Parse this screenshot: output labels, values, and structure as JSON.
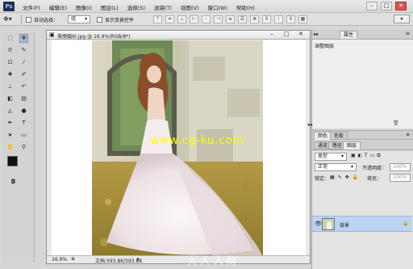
{
  "app": {
    "logo": "Ps",
    "menu": [
      "文件(F)",
      "编辑(E)",
      "图像(I)",
      "图层(L)",
      "选择(S)",
      "滤镜(T)",
      "视图(V)",
      "窗口(W)",
      "帮助(H)"
    ],
    "window_buttons": [
      "–",
      "□",
      "✕"
    ]
  },
  "options_bar": {
    "auto_select_label": "自动选择：",
    "auto_select_value": "组",
    "show_transform_label": "显示变换控件"
  },
  "document": {
    "title": "美丽婚纱.jpg @ 16.9%(RGB/8*)",
    "zoom": "16.9%",
    "doc_info": "文档:593.8K/593.8K",
    "window_buttons": [
      "–",
      "□",
      "✕"
    ]
  },
  "panels": {
    "top_tabs": [
      "属性"
    ],
    "top_label": "调整图层",
    "mid_tabs": [
      "颜色",
      "色板"
    ],
    "layers_tabs": [
      "图层",
      "通道",
      "路径"
    ],
    "kind_filter": "类型",
    "blend_mode": "正常",
    "opacity_label": "不透明度：",
    "opacity_value": "100%",
    "lock_label": "锁定：",
    "fill_label": "填充：",
    "fill_value": "100%",
    "layers": [
      {
        "name": "背景",
        "locked": true,
        "visible": true
      }
    ]
  },
  "watermarks": {
    "center": "www.cg-ku.com",
    "bottom": "大 人 人 网"
  },
  "colors": {
    "foreground": "#111111",
    "background": "#ffffff",
    "selected_layer": "#bad4f2",
    "watermark": "#ffff00"
  }
}
